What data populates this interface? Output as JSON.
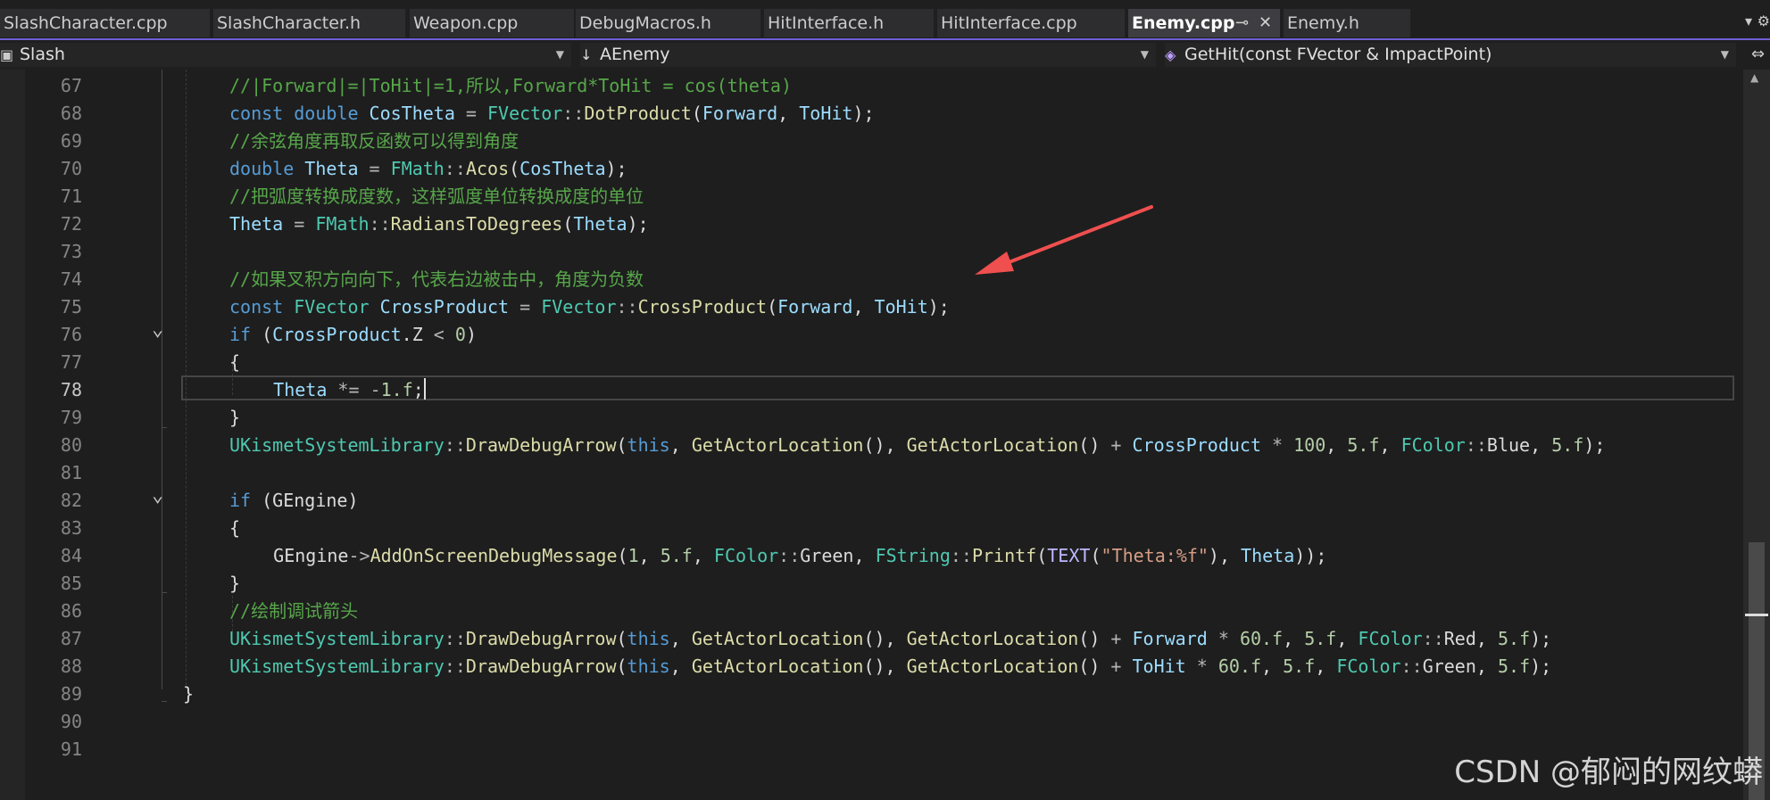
{
  "tabs": [
    {
      "label": "SlashCharacter.cpp",
      "active": false
    },
    {
      "label": "SlashCharacter.h",
      "active": false
    },
    {
      "label": "Weapon.cpp",
      "active": false
    },
    {
      "label": "DebugMacros.h",
      "active": false
    },
    {
      "label": "HitInterface.h",
      "active": false
    },
    {
      "label": "HitInterface.cpp",
      "active": false
    },
    {
      "label": "Enemy.cpp",
      "active": true
    },
    {
      "label": "Enemy.h",
      "active": false
    }
  ],
  "tab_pin_glyph": "⊸",
  "tab_close_glyph": "✕",
  "nav": {
    "project": "Slash",
    "class": "AEnemy",
    "member": "GetHit(const FVector & ImpactPoint)"
  },
  "lines": [
    {
      "n": "67",
      "parts": [
        [
          "t-cm",
          "//|Forward|=|ToHit|=1,所以,Forward*ToHit = cos(theta)"
        ]
      ]
    },
    {
      "n": "68",
      "parts": [
        [
          "t-kw",
          "const "
        ],
        [
          "t-kw",
          "double "
        ],
        [
          "t-var",
          "CosTheta"
        ],
        [
          "t-op",
          " = "
        ],
        [
          "t-ty",
          "FVector"
        ],
        [
          "t-op",
          "::"
        ],
        [
          "t-fn",
          "DotProduct"
        ],
        [
          "t-plain",
          "("
        ],
        [
          "t-var",
          "Forward"
        ],
        [
          "t-plain",
          ", "
        ],
        [
          "t-var",
          "ToHit"
        ],
        [
          "t-plain",
          ");"
        ]
      ]
    },
    {
      "n": "69",
      "parts": [
        [
          "t-cm",
          "//余弦角度再取反函数可以得到角度"
        ]
      ]
    },
    {
      "n": "70",
      "parts": [
        [
          "t-kw",
          "double "
        ],
        [
          "t-var",
          "Theta"
        ],
        [
          "t-op",
          " = "
        ],
        [
          "t-ty",
          "FMath"
        ],
        [
          "t-op",
          "::"
        ],
        [
          "t-fn",
          "Acos"
        ],
        [
          "t-plain",
          "("
        ],
        [
          "t-var",
          "CosTheta"
        ],
        [
          "t-plain",
          ");"
        ]
      ]
    },
    {
      "n": "71",
      "parts": [
        [
          "t-cm",
          "//把弧度转换成度数，这样弧度单位转换成度的单位"
        ]
      ]
    },
    {
      "n": "72",
      "parts": [
        [
          "t-var",
          "Theta"
        ],
        [
          "t-op",
          " = "
        ],
        [
          "t-ty",
          "FMath"
        ],
        [
          "t-op",
          "::"
        ],
        [
          "t-fn",
          "RadiansToDegrees"
        ],
        [
          "t-plain",
          "("
        ],
        [
          "t-var",
          "Theta"
        ],
        [
          "t-plain",
          ");"
        ]
      ]
    },
    {
      "n": "73",
      "parts": []
    },
    {
      "n": "74",
      "parts": [
        [
          "t-cm",
          "//如果叉积方向向下，代表右边被击中，角度为负数"
        ]
      ]
    },
    {
      "n": "75",
      "parts": [
        [
          "t-kw",
          "const "
        ],
        [
          "t-ty",
          "FVector "
        ],
        [
          "t-var",
          "CrossProduct"
        ],
        [
          "t-op",
          " = "
        ],
        [
          "t-ty",
          "FVector"
        ],
        [
          "t-op",
          "::"
        ],
        [
          "t-fn",
          "CrossProduct"
        ],
        [
          "t-plain",
          "("
        ],
        [
          "t-var",
          "Forward"
        ],
        [
          "t-plain",
          ", "
        ],
        [
          "t-var",
          "ToHit"
        ],
        [
          "t-plain",
          ");"
        ]
      ]
    },
    {
      "n": "76",
      "parts": [
        [
          "t-kw",
          "if "
        ],
        [
          "t-plain",
          "("
        ],
        [
          "t-var",
          "CrossProduct"
        ],
        [
          "t-plain",
          "."
        ],
        [
          "t-member",
          "Z"
        ],
        [
          "t-op",
          " < "
        ],
        [
          "t-num",
          "0"
        ],
        [
          "t-plain",
          ")"
        ]
      ]
    },
    {
      "n": "77",
      "parts": [
        [
          "t-plain",
          "{"
        ]
      ]
    },
    {
      "n": "78",
      "parts": [
        [
          "t-plain",
          "    "
        ],
        [
          "t-var",
          "Theta"
        ],
        [
          "t-op",
          " *= "
        ],
        [
          "t-op",
          "-"
        ],
        [
          "t-num",
          "1.f"
        ],
        [
          "t-plain",
          ";"
        ]
      ]
    },
    {
      "n": "79",
      "parts": [
        [
          "t-plain",
          "}"
        ]
      ]
    },
    {
      "n": "80",
      "parts": [
        [
          "t-ty",
          "UKismetSystemLibrary"
        ],
        [
          "t-op",
          "::"
        ],
        [
          "t-fn",
          "DrawDebugArrow"
        ],
        [
          "t-plain",
          "("
        ],
        [
          "t-kw",
          "this"
        ],
        [
          "t-plain",
          ", "
        ],
        [
          "t-fn",
          "GetActorLocation"
        ],
        [
          "t-plain",
          "(), "
        ],
        [
          "t-fn",
          "GetActorLocation"
        ],
        [
          "t-plain",
          "() "
        ],
        [
          "t-op",
          "+ "
        ],
        [
          "t-var",
          "CrossProduct"
        ],
        [
          "t-op",
          " * "
        ],
        [
          "t-num",
          "100"
        ],
        [
          "t-plain",
          ", "
        ],
        [
          "t-num",
          "5.f"
        ],
        [
          "t-plain",
          ", "
        ],
        [
          "t-ty",
          "FColor"
        ],
        [
          "t-op",
          "::"
        ],
        [
          "t-member",
          "Blue"
        ],
        [
          "t-plain",
          ", "
        ],
        [
          "t-num",
          "5.f"
        ],
        [
          "t-plain",
          ");"
        ]
      ]
    },
    {
      "n": "81",
      "parts": []
    },
    {
      "n": "82",
      "parts": [
        [
          "t-kw",
          "if "
        ],
        [
          "t-plain",
          "("
        ],
        [
          "t-plain",
          "GEngine"
        ],
        [
          "t-plain",
          ")"
        ]
      ]
    },
    {
      "n": "83",
      "parts": [
        [
          "t-plain",
          "{"
        ]
      ]
    },
    {
      "n": "84",
      "parts": [
        [
          "t-plain",
          "    "
        ],
        [
          "t-plain",
          "GEngine"
        ],
        [
          "t-op",
          "->"
        ],
        [
          "t-fn",
          "AddOnScreenDebugMessage"
        ],
        [
          "t-plain",
          "("
        ],
        [
          "t-num",
          "1"
        ],
        [
          "t-plain",
          ", "
        ],
        [
          "t-num",
          "5.f"
        ],
        [
          "t-plain",
          ", "
        ],
        [
          "t-ty",
          "FColor"
        ],
        [
          "t-op",
          "::"
        ],
        [
          "t-member",
          "Green"
        ],
        [
          "t-plain",
          ", "
        ],
        [
          "t-ty",
          "FString"
        ],
        [
          "t-op",
          "::"
        ],
        [
          "t-fn",
          "Printf"
        ],
        [
          "t-plain",
          "("
        ],
        [
          "t-mac",
          "TEXT"
        ],
        [
          "t-plain",
          "("
        ],
        [
          "t-str",
          "\"Theta:%f\""
        ],
        [
          "t-plain",
          "), "
        ],
        [
          "t-var",
          "Theta"
        ],
        [
          "t-plain",
          "));"
        ]
      ]
    },
    {
      "n": "85",
      "parts": [
        [
          "t-plain",
          "}"
        ]
      ]
    },
    {
      "n": "86",
      "parts": [
        [
          "t-cm",
          "//绘制调试箭头"
        ]
      ]
    },
    {
      "n": "87",
      "parts": [
        [
          "t-ty",
          "UKismetSystemLibrary"
        ],
        [
          "t-op",
          "::"
        ],
        [
          "t-fn",
          "DrawDebugArrow"
        ],
        [
          "t-plain",
          "("
        ],
        [
          "t-kw",
          "this"
        ],
        [
          "t-plain",
          ", "
        ],
        [
          "t-fn",
          "GetActorLocation"
        ],
        [
          "t-plain",
          "(), "
        ],
        [
          "t-fn",
          "GetActorLocation"
        ],
        [
          "t-plain",
          "() "
        ],
        [
          "t-op",
          "+ "
        ],
        [
          "t-var",
          "Forward"
        ],
        [
          "t-op",
          " * "
        ],
        [
          "t-num",
          "60.f"
        ],
        [
          "t-plain",
          ", "
        ],
        [
          "t-num",
          "5.f"
        ],
        [
          "t-plain",
          ", "
        ],
        [
          "t-ty",
          "FColor"
        ],
        [
          "t-op",
          "::"
        ],
        [
          "t-member",
          "Red"
        ],
        [
          "t-plain",
          ", "
        ],
        [
          "t-num",
          "5.f"
        ],
        [
          "t-plain",
          ");"
        ]
      ]
    },
    {
      "n": "88",
      "parts": [
        [
          "t-ty",
          "UKismetSystemLibrary"
        ],
        [
          "t-op",
          "::"
        ],
        [
          "t-fn",
          "DrawDebugArrow"
        ],
        [
          "t-plain",
          "("
        ],
        [
          "t-kw",
          "this"
        ],
        [
          "t-plain",
          ", "
        ],
        [
          "t-fn",
          "GetActorLocation"
        ],
        [
          "t-plain",
          "(), "
        ],
        [
          "t-fn",
          "GetActorLocation"
        ],
        [
          "t-plain",
          "() "
        ],
        [
          "t-op",
          "+ "
        ],
        [
          "t-var",
          "ToHit"
        ],
        [
          "t-op",
          " * "
        ],
        [
          "t-num",
          "60.f"
        ],
        [
          "t-plain",
          ", "
        ],
        [
          "t-num",
          "5.f"
        ],
        [
          "t-plain",
          ", "
        ],
        [
          "t-ty",
          "FColor"
        ],
        [
          "t-op",
          "::"
        ],
        [
          "t-member",
          "Green"
        ],
        [
          "t-plain",
          ", "
        ],
        [
          "t-num",
          "5.f"
        ],
        [
          "t-plain",
          ");"
        ]
      ]
    },
    {
      "n": "89",
      "parts": [
        [
          "t-plain",
          "}"
        ]
      ]
    },
    {
      "n": "90",
      "parts": []
    },
    {
      "n": "91",
      "parts": []
    }
  ],
  "current_line": "78",
  "fold_lines": [
    "76",
    "82"
  ],
  "watermark": "CSDN @郁闷的网纹蟒",
  "accent_color": "#6f5fd6",
  "annotation_arrow_color": "#ef4f4f"
}
